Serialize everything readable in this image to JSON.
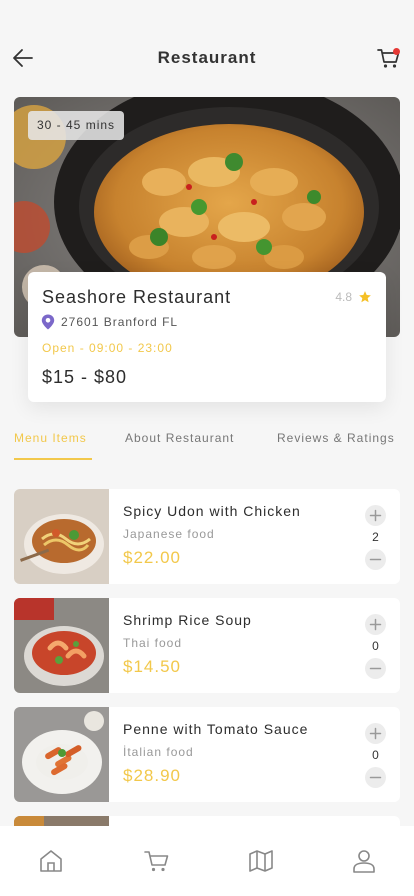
{
  "header": {
    "title": "Restaurant",
    "back_icon": "arrow-left-icon",
    "cart_icon": "cart-icon"
  },
  "restaurant": {
    "delivery_time": "30 - 45 mins",
    "name": "Seashore Restaurant",
    "rating": "4.8",
    "address": "27601 Branford FL",
    "hours": "Open - 09:00 - 23:00",
    "price_range": "$15 - $80"
  },
  "tabs": [
    {
      "label": "Menu Items",
      "active": true
    },
    {
      "label": "About Restaurant",
      "active": false
    },
    {
      "label": "Reviews & Ratings",
      "active": false
    }
  ],
  "menu_items": [
    {
      "name": "Spicy Udon with Chicken",
      "category": "Japanese food",
      "price": "$22.00",
      "quantity": "2"
    },
    {
      "name": "Shrimp Rice Soup",
      "category": "Thai food",
      "price": "$14.50",
      "quantity": "0"
    },
    {
      "name": "Penne with Tomato Sauce",
      "category": "İtalian food",
      "price": "$28.90",
      "quantity": "0"
    }
  ],
  "bottom_nav": [
    "home-icon",
    "cart-icon",
    "map-icon",
    "user-icon"
  ],
  "colors": {
    "accent": "#f2c84b",
    "badge_red": "#e53935",
    "pin_purple": "#7b68c9",
    "star": "#f5c026",
    "text_dark": "#2d2d2d",
    "text_muted": "#999999",
    "background": "#f6f6f6"
  }
}
